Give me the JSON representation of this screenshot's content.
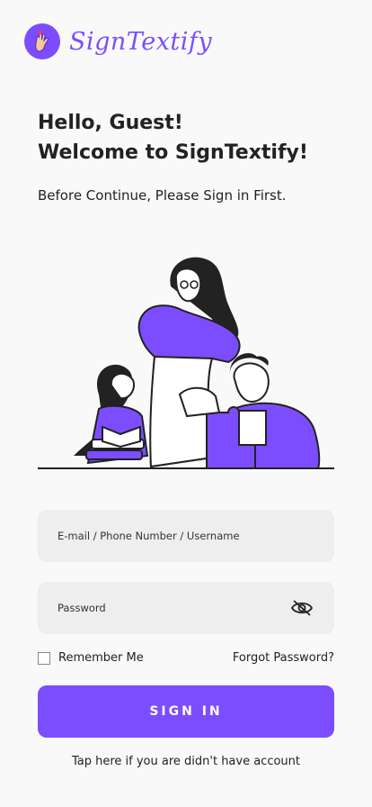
{
  "brand": {
    "name": "SignTextify"
  },
  "header": {
    "greeting_line1": "Hello, Guest!",
    "greeting_line2": "Welcome to SignTextify!",
    "subtitle": "Before Continue, Please Sign in First."
  },
  "form": {
    "username_placeholder": "E-mail / Phone Number / Username",
    "username_value": "",
    "password_placeholder": "Password",
    "password_value": "",
    "remember_label": "Remember Me",
    "remember_checked": false,
    "forgot_label": "Forgot Password?",
    "signin_label": "SIGN IN",
    "signup_prompt": "Tap here if you are didn't have account"
  },
  "colors": {
    "accent": "#7c4dff",
    "field_bg": "#eeeeee",
    "page_bg": "#f9f9f9"
  },
  "icons": {
    "logo": "hand-sign-icon",
    "password_toggle": "eye-slash-icon"
  }
}
